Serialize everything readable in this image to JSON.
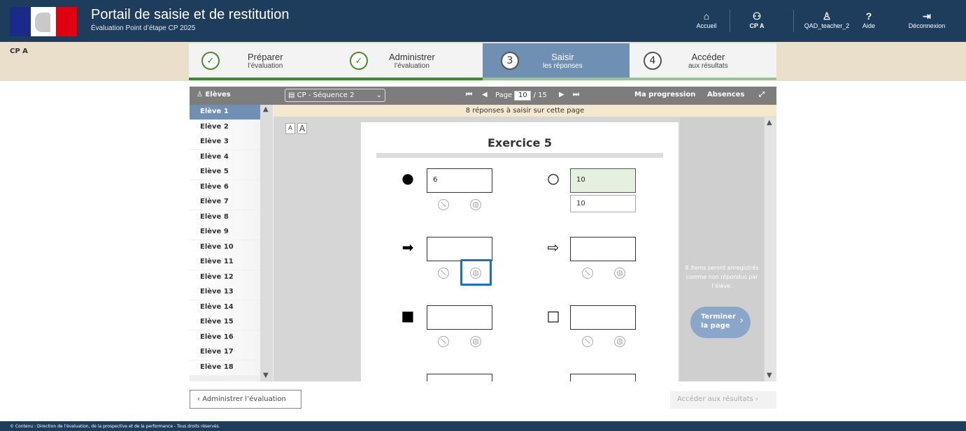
{
  "header": {
    "title": "Portail de saisie et de restitution",
    "subtitle": "Évaluation Point d’étape CP 2025",
    "nav": [
      {
        "label": "Accueil",
        "icon": "home-icon"
      },
      {
        "label": "CP A",
        "icon": "class-icon"
      },
      {
        "label": "QAD_teacher_2",
        "icon": "user-icon"
      },
      {
        "label": "Aide",
        "icon": "help-icon"
      },
      {
        "label": "Déconnexion",
        "icon": "logout-icon"
      }
    ]
  },
  "class_label": "CP A",
  "steps": [
    {
      "line1": "Préparer",
      "line2": "l’évaluation",
      "marker": "✓"
    },
    {
      "line1": "Administrer",
      "line2": "l’évaluation",
      "marker": "✓"
    },
    {
      "line1": "Saisir",
      "line2": "les réponses",
      "marker": "3"
    },
    {
      "line1": "Accéder",
      "line2": "aux résultats",
      "marker": "4"
    }
  ],
  "toolbar": {
    "students_label": "Elèves",
    "sequence": "CP - Séquence 2",
    "page_label": "Page",
    "page_current": "10",
    "page_total": "/ 15",
    "progress_label": "Ma progression",
    "absences_label": "Absences"
  },
  "students": [
    "Elève 1",
    "Elève 2",
    "Elève 3",
    "Elève 4",
    "Elève 5",
    "Elève 6",
    "Elève 7",
    "Elève 8",
    "Elève 9",
    "Elève 10",
    "Elève 11",
    "Elève 12",
    "Elève 13",
    "Elève 14",
    "Elève 15",
    "Elève 16",
    "Elève 17",
    "Elève 18"
  ],
  "info_message": "8 réponses à saisir sur cette page",
  "font_buttons": [
    "A",
    "A"
  ],
  "exercise": {
    "title": "Exercice 5",
    "items": [
      {
        "symbol": "●",
        "value": "6"
      },
      {
        "symbol": "○",
        "value": "10",
        "suggestion": "10"
      },
      {
        "symbol": "➡",
        "value": ""
      },
      {
        "symbol": "⇨",
        "value": ""
      },
      {
        "symbol": "■",
        "value": ""
      },
      {
        "symbol": "□",
        "value": ""
      }
    ]
  },
  "side_note": "8 items seront enregistrés comme non répondus par l’élève.",
  "finish_button": {
    "line1": "Terminer",
    "line2": "la page"
  },
  "bottom": {
    "back_button": "Administrer l’évaluation",
    "next_button": "Accéder aux résultats"
  },
  "footer": "© Contenu : Direction de l’évaluation, de la prospective et de la performance - Tous droits réservés."
}
